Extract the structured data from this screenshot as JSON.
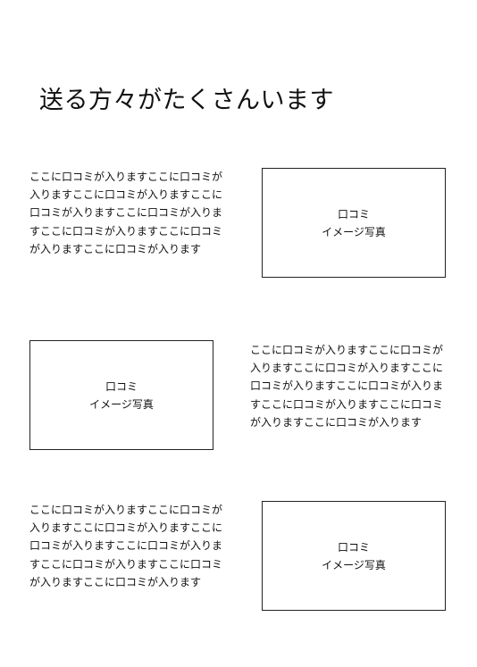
{
  "page": {
    "title": "送る方々がたくさんいます"
  },
  "reviews": [
    {
      "text": "ここに口コミが入りますここに口コミが入りますここに口コミが入りますここに口コミが入りますここに口コミが入りますここに口コミが入りますここに口コミが入りますここに口コミが入ります",
      "photo_label_line1": "口コミ",
      "photo_label_line2": "イメージ写真"
    },
    {
      "text": "ここに口コミが入りますここに口コミが入りますここに口コミが入りますここに口コミが入りますここに口コミが入りますここに口コミが入りますここに口コミが入りますここに口コミが入ります",
      "photo_label_line1": "口コミ",
      "photo_label_line2": "イメージ写真"
    },
    {
      "text": "ここに口コミが入りますここに口コミが入りますここに口コミが入りますここに口コミが入りますここに口コミが入りますここに口コミが入りますここに口コミが入りますここに口コミが入ります",
      "photo_label_line1": "口コミ",
      "photo_label_line2": "イメージ写真"
    }
  ]
}
